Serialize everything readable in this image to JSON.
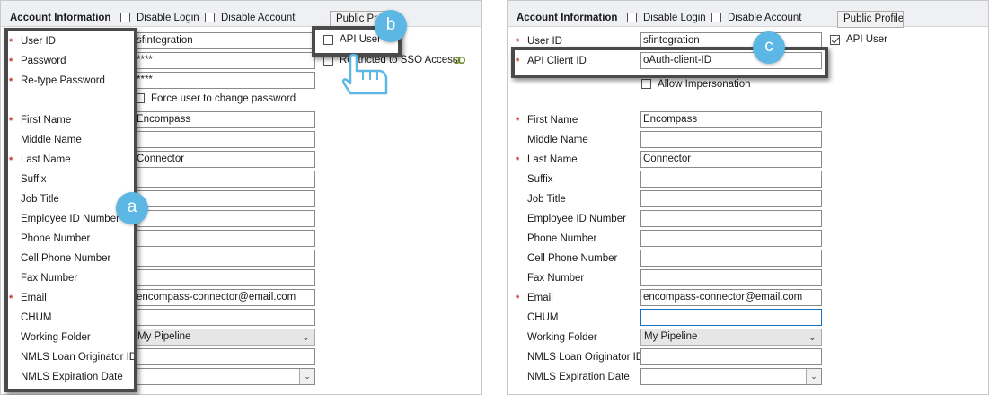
{
  "header": {
    "title": "Account Information",
    "disable_login_label": "Disable Login",
    "disable_account_label": "Disable Account",
    "public_profile_label": "Public Profile",
    "public_profile_label_left": "Public Pro"
  },
  "left": {
    "api_user_label": "API User",
    "restricted_label": "Restricted to SSO Access",
    "force_change_label": "Force user to change password",
    "fields": {
      "user_id": {
        "label": "User ID",
        "value": "sfintegration"
      },
      "password": {
        "label": "Password",
        "value": "****"
      },
      "retype": {
        "label": "Re-type Password",
        "value": "****"
      },
      "first_name": {
        "label": "First Name",
        "value": "Encompass"
      },
      "middle_name": {
        "label": "Middle Name",
        "value": ""
      },
      "last_name": {
        "label": "Last Name",
        "value": "Connector"
      },
      "suffix": {
        "label": "Suffix",
        "value": ""
      },
      "job_title": {
        "label": "Job Title",
        "value": ""
      },
      "employee_id": {
        "label": "Employee ID Number",
        "value": ""
      },
      "phone": {
        "label": "Phone Number",
        "value": ""
      },
      "cell": {
        "label": "Cell Phone Number",
        "value": ""
      },
      "fax": {
        "label": "Fax Number",
        "value": ""
      },
      "email": {
        "label": "Email",
        "value": "encompass-connector@email.com"
      },
      "chum": {
        "label": "CHUM",
        "value": ""
      },
      "folder": {
        "label": "Working Folder",
        "value": "My Pipeline"
      },
      "nmls_id": {
        "label": "NMLS Loan Originator ID",
        "value": ""
      },
      "nmls_exp": {
        "label": "NMLS Expiration Date",
        "value": ""
      }
    }
  },
  "right": {
    "api_user_label": "API User",
    "allow_impersonation_label": "Allow Impersonation",
    "fields": {
      "user_id": {
        "label": "User ID",
        "value": "sfintegration"
      },
      "api_client_id": {
        "label": "API Client ID",
        "value": "oAuth-client-ID"
      },
      "first_name": {
        "label": "First Name",
        "value": "Encompass"
      },
      "middle_name": {
        "label": "Middle Name",
        "value": ""
      },
      "last_name": {
        "label": "Last Name",
        "value": "Connector"
      },
      "suffix": {
        "label": "Suffix",
        "value": ""
      },
      "job_title": {
        "label": "Job Title",
        "value": ""
      },
      "employee_id": {
        "label": "Employee ID Number",
        "value": ""
      },
      "phone": {
        "label": "Phone Number",
        "value": ""
      },
      "cell": {
        "label": "Cell Phone Number",
        "value": ""
      },
      "fax": {
        "label": "Fax Number",
        "value": ""
      },
      "email": {
        "label": "Email",
        "value": "encompass-connector@email.com"
      },
      "chum": {
        "label": "CHUM",
        "value": ""
      },
      "folder": {
        "label": "Working Folder",
        "value": "My Pipeline"
      },
      "nmls_id": {
        "label": "NMLS Loan Originator ID",
        "value": ""
      },
      "nmls_exp": {
        "label": "NMLS Expiration Date",
        "value": ""
      }
    }
  },
  "callouts": {
    "a": "a",
    "b": "b",
    "c": "c"
  },
  "icons": {
    "required": "required-star-icon",
    "dropdown": "chevron-down-icon",
    "pointer": "hand-pointer-icon",
    "link": "chain-link-icon"
  },
  "colors": {
    "required": "#c0392b",
    "callout": "#5cb7e4",
    "highlight": "#4a4a4a"
  }
}
